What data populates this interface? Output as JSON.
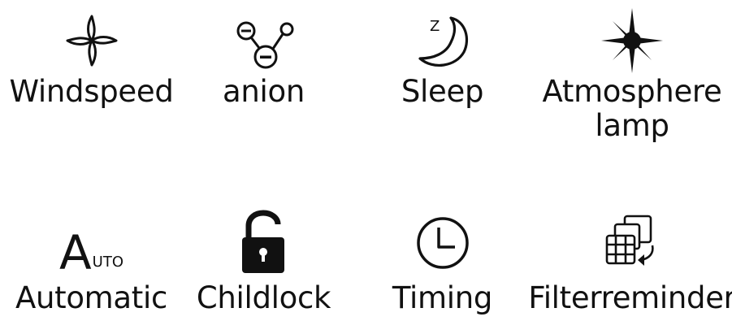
{
  "features": [
    {
      "label": "Windspeed",
      "icon": "fan-icon"
    },
    {
      "label": "anion",
      "icon": "anion-molecule-icon"
    },
    {
      "label": "Sleep",
      "icon": "moon-sleep-icon",
      "badge": "Z"
    },
    {
      "label": "Atmosphere lamp",
      "icon": "sparkle-lamp-icon"
    },
    {
      "label": "Automatic",
      "icon": "auto-icon",
      "icon_text_big": "A",
      "icon_text_small": "UTO"
    },
    {
      "label": "Childlock",
      "icon": "unlocked-padlock-icon"
    },
    {
      "label": "Timing",
      "icon": "clock-icon"
    },
    {
      "label": "Filterreminder",
      "icon": "filter-reminder-icon"
    }
  ],
  "colors": {
    "icon": "#111111",
    "background": "#ffffff"
  }
}
